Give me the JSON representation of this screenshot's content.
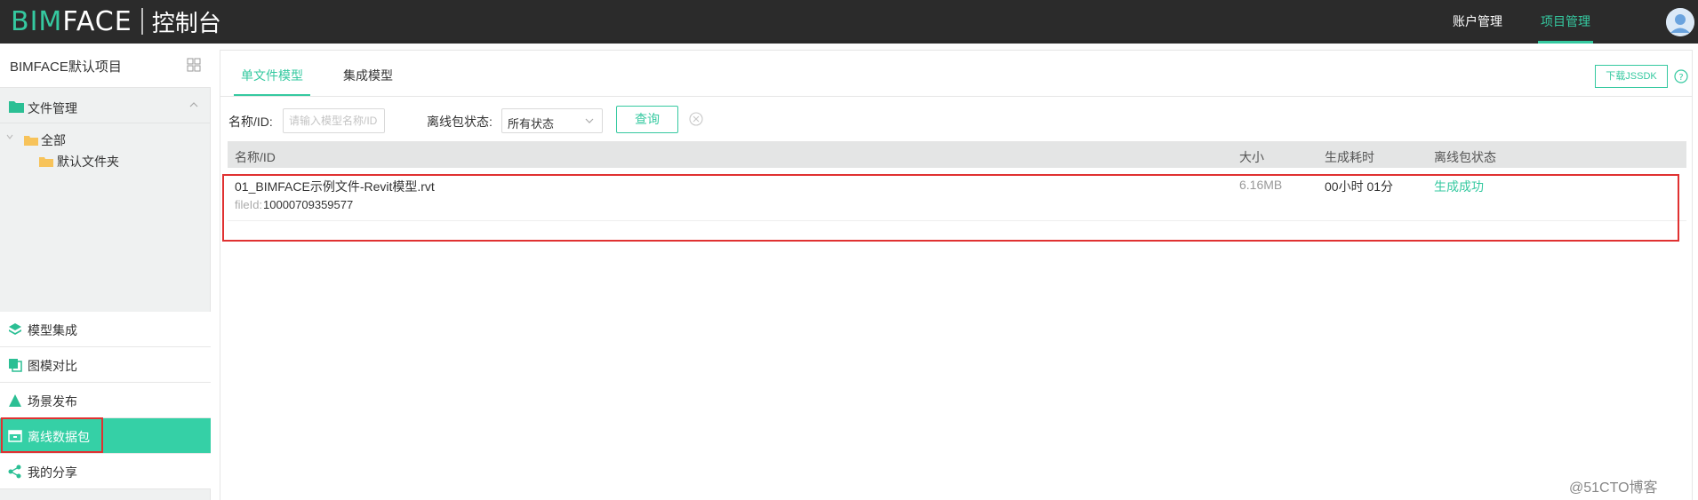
{
  "header": {
    "logo_bim": "BIM",
    "logo_face": "FACE",
    "logo_console": "控制台",
    "nav": [
      "账户管理",
      "项目管理"
    ],
    "active_nav": "项目管理",
    "accent_color": "#35c9a0"
  },
  "sidebar": {
    "project_title": "BIMFACE默认项目",
    "file_management": "文件管理",
    "tree": {
      "all": "全部",
      "default_folder": "默认文件夹"
    },
    "menu": [
      {
        "label": "模型集成",
        "icon": "layers-icon"
      },
      {
        "label": "图模对比",
        "icon": "compare-icon"
      },
      {
        "label": "场景发布",
        "icon": "triangle-icon"
      },
      {
        "label": "离线数据包",
        "icon": "package-icon",
        "active": true
      },
      {
        "label": "我的分享",
        "icon": "share-icon"
      }
    ]
  },
  "main": {
    "tabs": [
      "单文件模型",
      "集成模型"
    ],
    "active_tab": "单文件模型",
    "download_jssdk": "下载JSSDK",
    "filter": {
      "name_label": "名称/ID:",
      "name_placeholder": "请输入模型名称/ID",
      "status_label": "离线包状态:",
      "status_value": "所有状态",
      "query_button": "查询"
    },
    "table": {
      "columns": [
        "名称/ID",
        "大小",
        "生成耗时",
        "离线包状态"
      ],
      "rows": [
        {
          "name": "01_BIMFACE示例文件-Revit模型.rvt",
          "fileid_label": "fileId:",
          "fileid": "10000709359577",
          "size": "6.16MB",
          "duration": "00小时 01分",
          "status": "生成成功"
        }
      ]
    }
  },
  "watermark": "@51CTO博客"
}
